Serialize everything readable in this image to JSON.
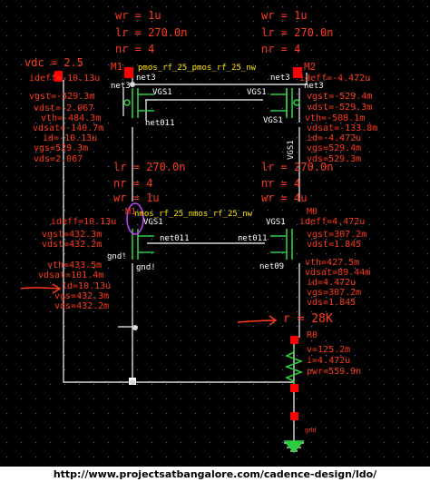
{
  "colors": {
    "background": "#000000",
    "wire": "#d8d8d8",
    "annotation": "#ff3a1a",
    "label": "#ffffff",
    "device": "#2ecc40",
    "model": "#ffe600",
    "pin": "#ff0000",
    "select_ring": "#c040ff",
    "grid_dot": "#5a5a9a"
  },
  "devices": {
    "m1": {
      "name": "M1",
      "wr": "wr = 1u",
      "lr": "lr = 270.0n",
      "nr": "nr = 4",
      "vdc": "vdc = 2.5",
      "ops": [
        "ideff=-10.13u",
        "vgst=-529.3m",
        "vdst=-2.067",
        "vth=-484.3m",
        "vdsat=-140.7m",
        "id=-10.13u",
        "vgs=529.3m",
        "vds=2.067"
      ]
    },
    "m2": {
      "name": "M2",
      "wr": "wr = 1u",
      "lr": "lr = 270.0n",
      "nr": "nr = 4",
      "ops": [
        "ideff=-4.472u",
        "vgst=-529.4m",
        "vdst=-529.3m",
        "vth=-508.1m",
        "vdsat=-133.8m",
        "id=-4.472u",
        "vgs=529.4m",
        "vds=529.3m"
      ]
    },
    "m1n": {
      "name": "M1",
      "lr": "lr = 270.0n",
      "nr": "nr = 4",
      "wr": "wr = 1u",
      "ops_top": [
        "ideff=10.13u",
        "vgst=432.3m",
        "vdst=432.2m"
      ],
      "ops_bot": [
        "vth=433.5m",
        "vdsat=101.4m",
        "id=10.13u",
        "vgs=432.3m",
        "vds=432.2m"
      ]
    },
    "m0": {
      "name": "M0",
      "lr": "lr = 270.0n",
      "nr": "nr = 4",
      "wr": "wr = 4u",
      "ops_top": [
        "ideff=4.472u",
        "vgst=307.2m",
        "vdst=1.845"
      ],
      "ops_bot": [
        "vth=427.5m",
        "vdsat=89.44m",
        "id=4.472u",
        "vgs=307.2m",
        "vds=1.845"
      ]
    },
    "r0": {
      "name": "R0",
      "r": "r = 28K",
      "ops": [
        "v=125.2m",
        "i=4.472u",
        "pwr=559.9n"
      ]
    }
  },
  "models": {
    "pmos": "pmos_rf_25_pmos_rf_25_nw",
    "nmos": "nmos_rf_25_nmos_rf_25_nw"
  },
  "nets": {
    "net3a": "net3",
    "net3b": "net3",
    "net3c": "net3",
    "net3d": "net3",
    "vgs1_tl": "VGS1",
    "vgs1_tr": "VGS1",
    "vgs1_side": "VGS1",
    "vgs1_bl": "VGS1",
    "vgs1_br": "VGS1",
    "net011a": "net011",
    "net011b": "net011",
    "net011c": "net011",
    "net09": "net09",
    "gnd1": "gnd!",
    "gnd2": "gnd!",
    "gnd3": "gnd"
  },
  "footer": "http://www.projectsatbangalore.com/cadence-design/ldo/"
}
